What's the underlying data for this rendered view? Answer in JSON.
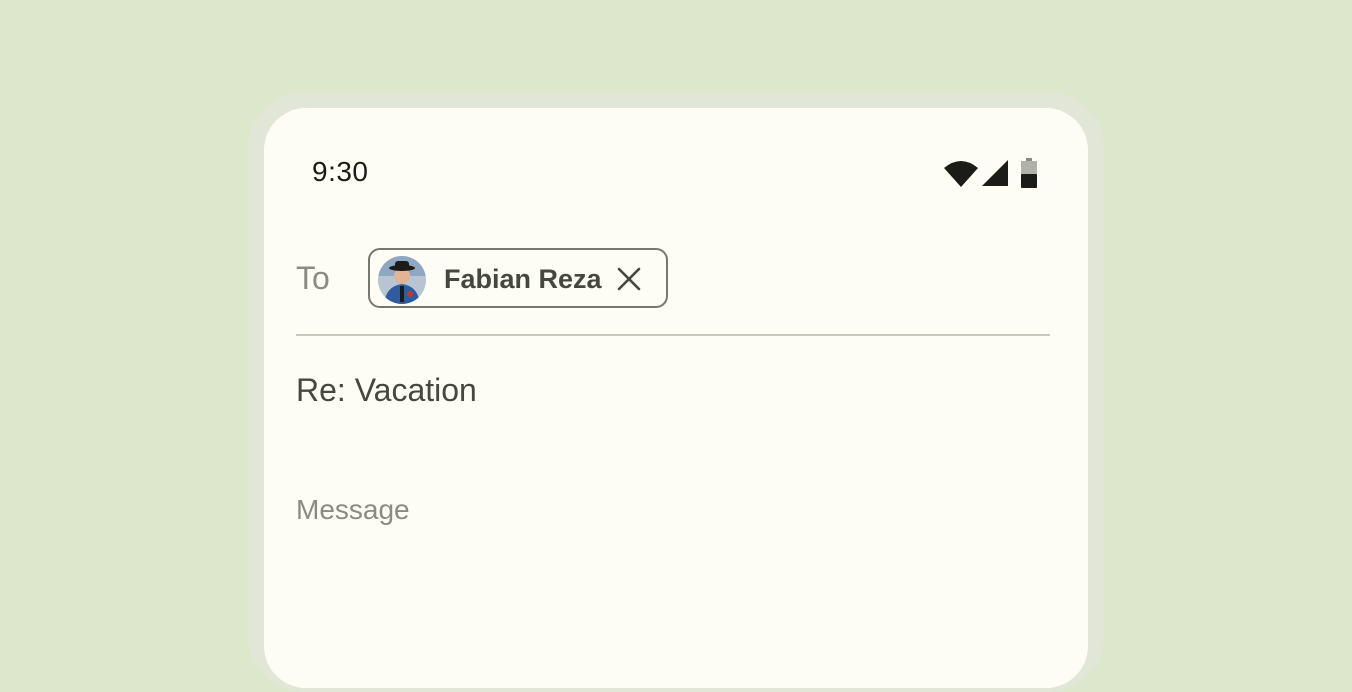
{
  "status_bar": {
    "time": "9:30",
    "icons": [
      "wifi-icon",
      "cellular-signal-icon",
      "battery-icon"
    ]
  },
  "compose": {
    "to_label": "To",
    "recipient_chip": {
      "name": "Fabian Reza",
      "avatar": "avatar",
      "remove_icon": "close-icon"
    },
    "subject": "Re: Vacation",
    "message_placeholder": "Message"
  },
  "colors": {
    "background": "#dce7cb",
    "bezel": "#e1e6d6",
    "screen": "#fdfdf5",
    "text_primary": "#45483f",
    "text_muted": "#8a8c82",
    "chip_border": "#76786d",
    "divider": "#c5c8ba"
  }
}
